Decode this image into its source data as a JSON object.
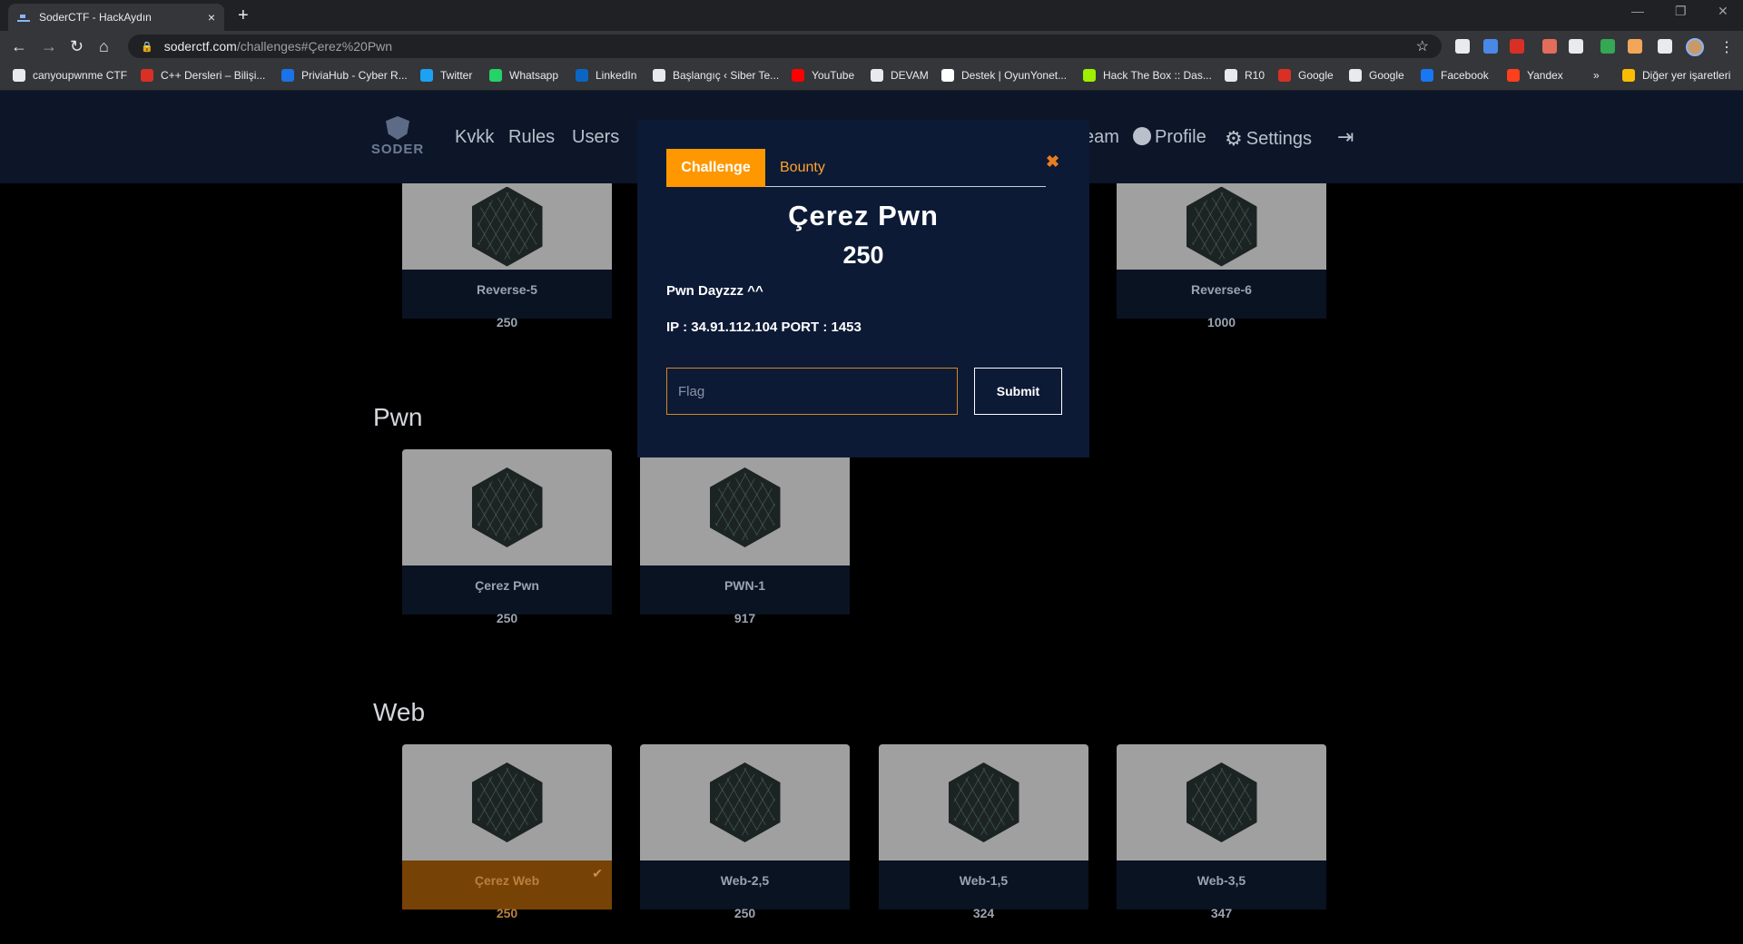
{
  "browser": {
    "tab_title": "SoderCTF - HackAydın",
    "tab_close": "×",
    "new_tab": "+",
    "window_controls": {
      "minimize": "—",
      "restore": "❐",
      "close": "✕"
    },
    "nav": {
      "back": "←",
      "forward": "→",
      "reload": "↻",
      "home": "⌂"
    },
    "url_domain": "soderctf.com",
    "url_path": "/challenges#Çerez%20Pwn",
    "lock": "🔒",
    "star": "☆",
    "kebab": "⋮",
    "ext_colors": [
      "#e8eaed",
      "#4a88e8",
      "#d93025",
      "#e26d5a",
      "#e8eaed",
      "#34a853",
      "#f2a65a",
      "#e8eaed"
    ],
    "bookmarks": [
      {
        "label": "canyoupwnme CTF",
        "color": "#e8eaed"
      },
      {
        "label": "C++ Dersleri – Bilişi...",
        "color": "#d93025"
      },
      {
        "label": "PriviaHub - Cyber R...",
        "color": "#1a73e8"
      },
      {
        "label": "Twitter",
        "color": "#1da1f2"
      },
      {
        "label": "Whatsapp",
        "color": "#25d366"
      },
      {
        "label": "LinkedIn",
        "color": "#0a66c2"
      },
      {
        "label": "Başlangıç ‹ Siber Te...",
        "color": "#e8eaed"
      },
      {
        "label": "YouTube",
        "color": "#ff0000"
      },
      {
        "label": "DEVAM",
        "color": "#e8eaed"
      },
      {
        "label": "Destek | OyunYonet...",
        "color": "#ffffff"
      },
      {
        "label": "Hack The Box :: Das...",
        "color": "#9fef00"
      },
      {
        "label": "R10",
        "color": "#e8eaed"
      },
      {
        "label": "Google",
        "color": "#d93025"
      },
      {
        "label": "Google",
        "color": "#e8eaed"
      },
      {
        "label": "Facebook",
        "color": "#1877f2"
      },
      {
        "label": "Yandex",
        "color": "#fc3f1d"
      }
    ],
    "bookmarks_more": "»",
    "other_bookmarks": "Diğer yer işaretleri"
  },
  "site": {
    "logo_text": "SODER",
    "nav": {
      "kvkk": "Kvkk",
      "rules": "Rules",
      "users": "Users",
      "team": "eam",
      "profile": "Profile",
      "settings": "Settings",
      "gear_glyph": "⚙",
      "logout_glyph": "⇥"
    },
    "sections": {
      "pwn": "Pwn",
      "web": "Web"
    },
    "cards_top": [
      {
        "name": "Reverse-5",
        "points": "250"
      },
      {
        "name": "Reverse-6",
        "points": "1000"
      }
    ],
    "cards_pwn": [
      {
        "name": "Çerez Pwn",
        "points": "250"
      },
      {
        "name": "PWN-1",
        "points": "917"
      }
    ],
    "cards_web": [
      {
        "name": "Çerez Web",
        "points": "250",
        "solved": true
      },
      {
        "name": "Web-2,5",
        "points": "250"
      },
      {
        "name": "Web-1,5",
        "points": "324"
      },
      {
        "name": "Web-3,5",
        "points": "347"
      }
    ],
    "check_glyph": "✔"
  },
  "modal": {
    "tab_challenge": "Challenge",
    "tab_bounty": "Bounty",
    "close": "✖",
    "title": "Çerez Pwn",
    "points": "250",
    "description": "Pwn Dayzzz ^^",
    "connection": "IP : 34.91.112.104 PORT : 1453",
    "flag_placeholder": "Flag",
    "flag_value": "",
    "submit": "Submit"
  },
  "colors": {
    "accent": "#ff9800",
    "modal_bg": "#0c1a36",
    "navbar_bg": "#0c1628",
    "solved_card": "#774205"
  }
}
